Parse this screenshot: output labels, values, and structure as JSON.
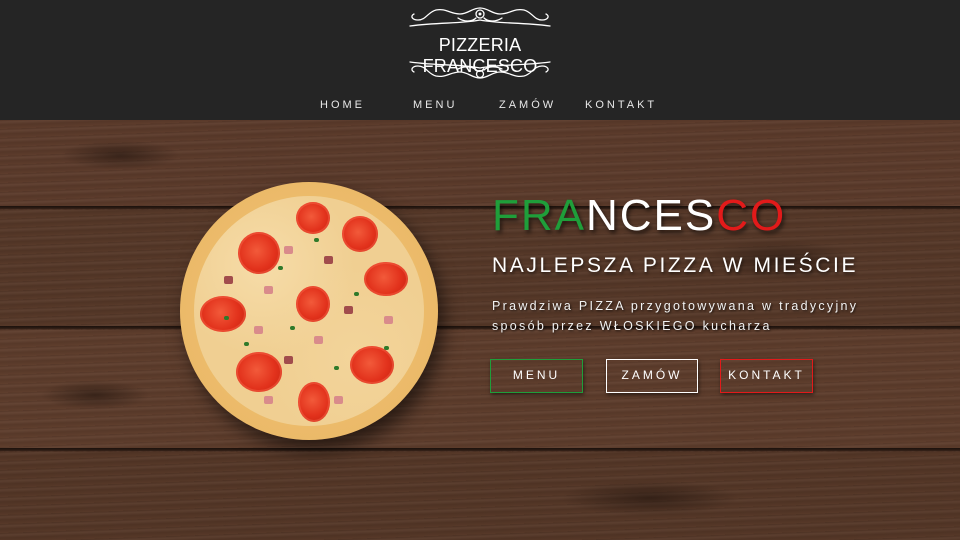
{
  "header": {
    "logo_title": "PIZZERIA FRANCESCO"
  },
  "nav": {
    "items": [
      {
        "label": "HOME"
      },
      {
        "label": "MENU"
      },
      {
        "label": "ZAMÓW"
      },
      {
        "label": "KONTAKT"
      }
    ]
  },
  "hero": {
    "brand": {
      "green": "FRA",
      "white": "NCES",
      "red": "CO"
    },
    "tagline": "NAJLEPSZA PIZZA W MIEŚCIE",
    "description_line1": "Prawdziwa PIZZA przygotowywana w tradycyjny",
    "description_line2": "sposób przez WŁOSKIEGO kucharza",
    "buttons": {
      "menu": "MENU",
      "zamow": "ZAMÓW",
      "kontakt": "KONTAKT"
    }
  },
  "colors": {
    "header_bg": "#252525",
    "italian_green": "#1f9e3a",
    "italian_white": "#ffffff",
    "italian_red": "#e21a1a",
    "wood": "#5a3a2a"
  },
  "icons": {
    "logo_ornament": "flourish-ornament-icon",
    "hero_image": "pizza-image"
  }
}
